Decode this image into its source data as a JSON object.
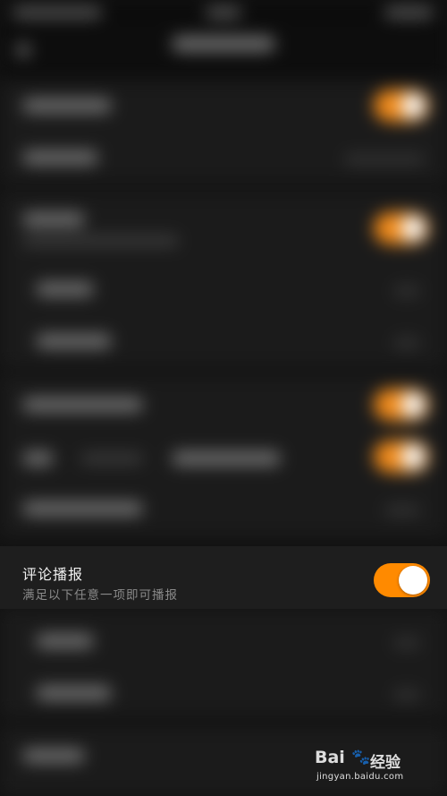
{
  "comment_broadcast": {
    "title": "评论播报",
    "subtitle": "满足以下任意一项即可播报",
    "toggle": {
      "state": "on",
      "color": "#ff8a00"
    }
  },
  "watermark": {
    "brand": "Bai",
    "brand_cn": "经验",
    "url": "jingyan.baidu.com"
  }
}
